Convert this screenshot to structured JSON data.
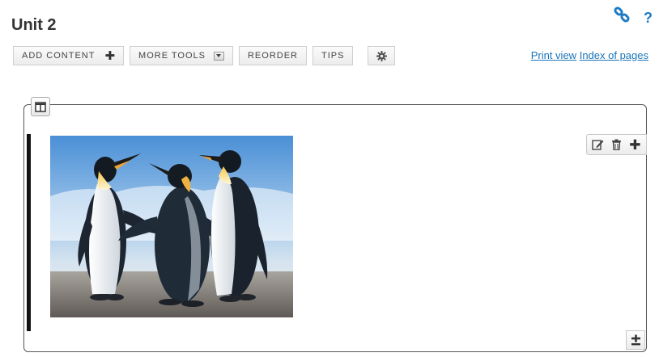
{
  "page": {
    "title": "Unit 2"
  },
  "header_icons": [
    {
      "name": "link-icon",
      "color": "#1f7ac4"
    },
    {
      "name": "help-icon",
      "glyph": "?",
      "color": "#1f7ac4"
    }
  ],
  "toolbar": {
    "add_content_label": "ADD CONTENT",
    "add_content_icon": "plus-icon",
    "more_tools_label": "MORE TOOLS",
    "more_tools_icon": "dropdown-arrow-icon",
    "reorder_label": "REORDER",
    "tips_label": "TIPS",
    "settings_icon": "gear-icon"
  },
  "links": {
    "print_view": "Print view",
    "index_of_pages": "Index of pages",
    "color": "#1a73b8"
  },
  "content": {
    "layout_toggle_icon": "two-column-layout-icon",
    "image_subject": "emperor-penguins-image",
    "block_tools": [
      "edit-icon",
      "trash-icon",
      "plus-icon"
    ],
    "bottom_add_icon": "plus-minus-icon"
  }
}
